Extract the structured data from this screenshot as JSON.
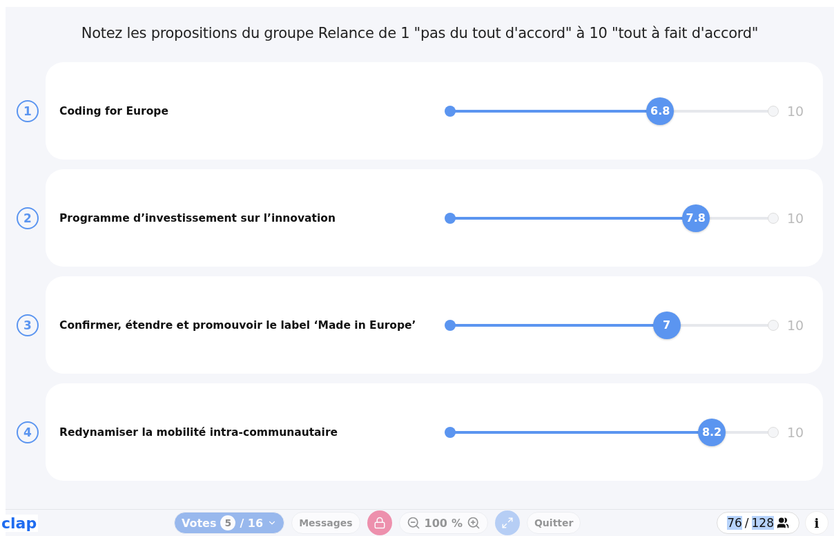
{
  "title": "Notez les propositions du groupe Relance de 1 \"pas du tout d'accord\" à 10 \"tout à fait d'accord\"",
  "propositions": [
    {
      "number": "1",
      "label": "Coding for Europe",
      "value": "6.8",
      "level": 0.65,
      "max": "10"
    },
    {
      "number": "2",
      "label": "Programme d’investissement sur l’innovation",
      "value": "7.8",
      "level": 0.76,
      "max": "10"
    },
    {
      "number": "3",
      "label": "Confirmer, étendre et promouvoir le label ‘Made in Europe’",
      "value": "7",
      "level": 0.67,
      "max": "10"
    },
    {
      "number": "4",
      "label": "Redynamiser la mobilité intra-communautaire",
      "value": "8.2",
      "level": 0.81,
      "max": "10"
    }
  ],
  "footer": {
    "logo": "clap",
    "votes_label": "Votes",
    "votes_current": "5",
    "votes_total": "/ 16",
    "messages": "Messages",
    "zoom": "100",
    "zoom_unit": "%",
    "quit": "Quitter",
    "participants": "76",
    "participants_sep": "/",
    "participants_total": "128",
    "info": "i"
  }
}
